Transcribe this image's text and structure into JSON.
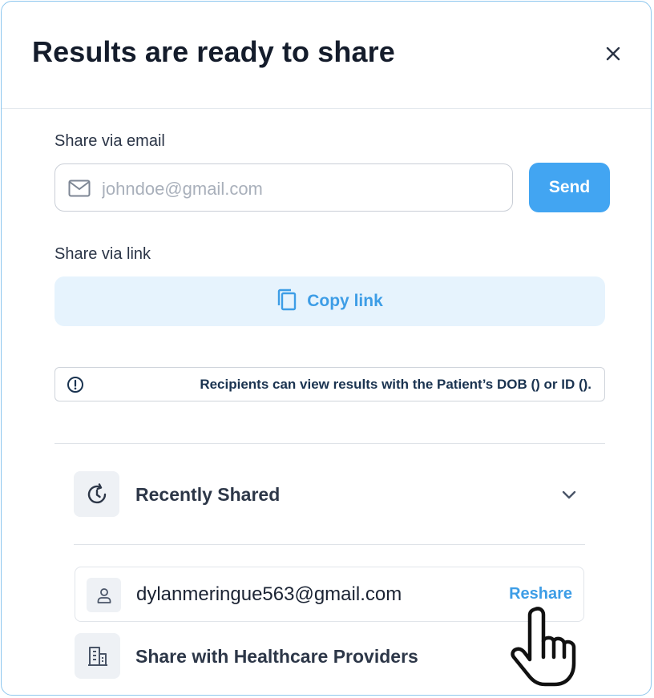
{
  "dialog": {
    "title": "Results are ready to share",
    "close_icon": "close-icon"
  },
  "email_share": {
    "label": "Share via email",
    "placeholder": "johndoe@gmail.com",
    "value": "",
    "icon": "mail-icon",
    "send_label": "Send"
  },
  "link_share": {
    "label": "Share via link",
    "icon": "copy-icon",
    "copy_label": "Copy link"
  },
  "notice": {
    "icon": "info-icon",
    "text": "Recipients can view results with the Patient’s DOB () or ID ()."
  },
  "recently_shared": {
    "title": "Recently Shared",
    "icon": "history-icon",
    "expanded": true,
    "items": [
      {
        "email": "dylanmeringue563@gmail.com",
        "action_label": "Reshare",
        "icon": "user-icon"
      }
    ]
  },
  "healthcare": {
    "title": "Share with Healthcare Providers",
    "icon": "building-icon"
  },
  "colors": {
    "accent": "#42a5f2",
    "accent_text": "#3d9de6",
    "accent_soft": "#e6f3fd",
    "border": "#8ec7ee"
  }
}
